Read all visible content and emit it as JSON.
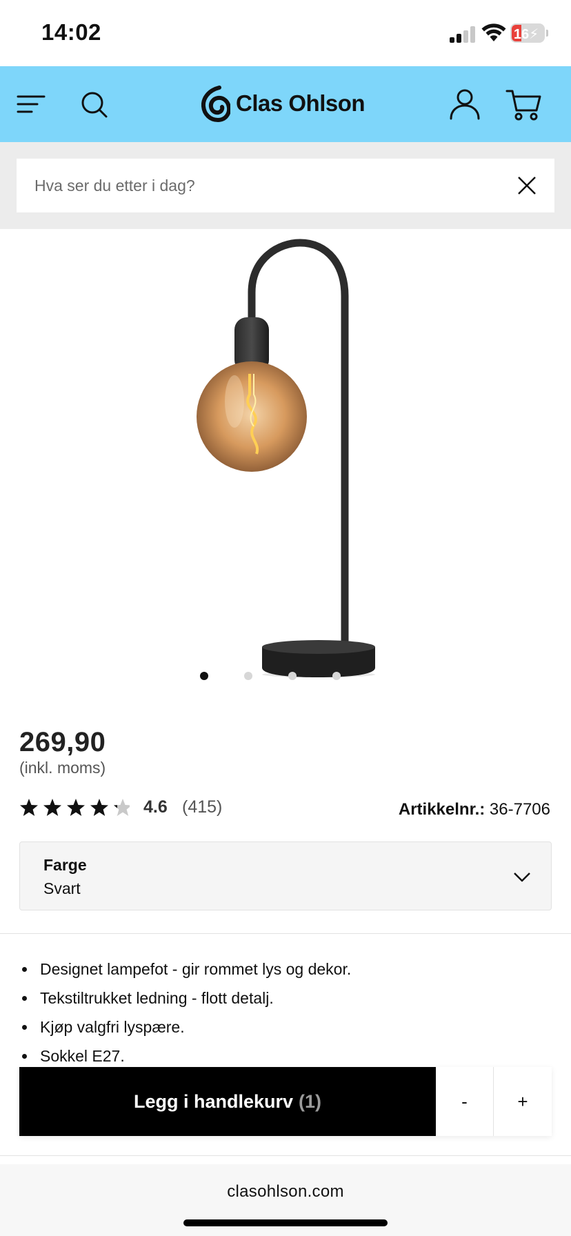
{
  "status_bar": {
    "time": "14:02",
    "battery": "16",
    "battery_color": "#e8403a"
  },
  "header": {
    "menu_icon": "hamburger-menu-icon",
    "search_icon": "search-icon",
    "logo_text": "Clas Ohlson",
    "account_icon": "user-icon",
    "cart_icon": "cart-icon",
    "background": "#7ed6fa"
  },
  "search": {
    "placeholder": "Hva ser du etter i dag?",
    "value": ""
  },
  "gallery": {
    "image_count": 4,
    "active_index": 0
  },
  "product": {
    "price": "269,90",
    "vat_note": "(inkl. moms)",
    "rating": "4.6",
    "rating_count": "(415)",
    "sku_label": "Artikkelnr.:",
    "sku_value": "36-7706"
  },
  "color_selector": {
    "label": "Farge",
    "value": "Svart"
  },
  "bullets": [
    "Designet lampefot - gir rommet lys og dekor.",
    "Tekstiltrukket ledning - flott detalj.",
    "Kjøp valgfri lyspære.",
    "Sokkel E27."
  ],
  "cart": {
    "add_label": "Legg i handlekurv",
    "quantity": "(1)",
    "minus_label": "-",
    "plus_label": "+"
  },
  "browser": {
    "url": "clasohlson.com"
  }
}
